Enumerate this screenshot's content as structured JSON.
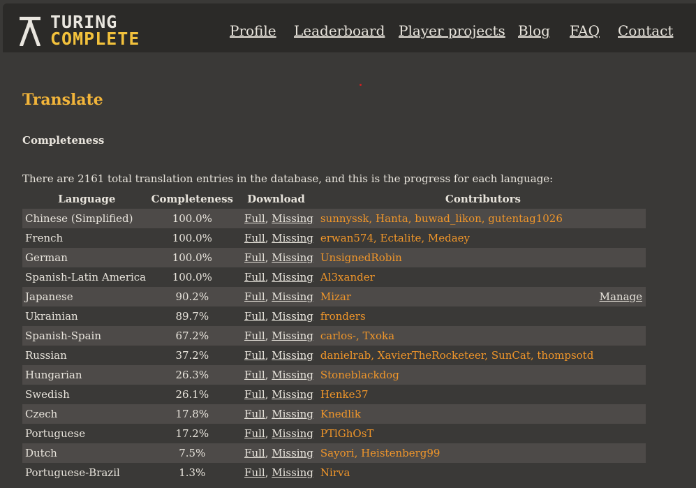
{
  "header": {
    "logo_line1": "TURING",
    "logo_line2": "COMPLETE",
    "nav": [
      "Profile",
      "Leaderboard",
      "Player projects",
      "Blog",
      "FAQ",
      "Contact"
    ]
  },
  "page": {
    "title": "Translate",
    "section": "Completeness",
    "intro": "There are 2161 total translation entries in the database, and this is the progress for each language:"
  },
  "table": {
    "headers": [
      "Language",
      "Completeness",
      "Download",
      "Contributors"
    ],
    "full_label": "Full",
    "missing_label": "Missing",
    "separator": ", ",
    "manage_label": "Manage",
    "rows": [
      {
        "language": "Chinese (Simplified)",
        "completeness": "100.0%",
        "contributors": "sunnyssk, Hanta, buwad_likon, gutentag1026"
      },
      {
        "language": "French",
        "completeness": "100.0%",
        "contributors": "erwan574, Ectalite, Medaey"
      },
      {
        "language": "German",
        "completeness": "100.0%",
        "contributors": "UnsignedRobin"
      },
      {
        "language": "Spanish-Latin America",
        "completeness": "100.0%",
        "contributors": "Al3xander"
      },
      {
        "language": "Japanese",
        "completeness": "90.2%",
        "contributors": "Mizar",
        "manage": true
      },
      {
        "language": "Ukrainian",
        "completeness": "89.7%",
        "contributors": "fronders"
      },
      {
        "language": "Spanish-Spain",
        "completeness": "67.2%",
        "contributors": "carlos-, Txoka"
      },
      {
        "language": "Russian",
        "completeness": "37.2%",
        "contributors": "danielrab, XavierTheRocketeer, SunCat, thompsotd"
      },
      {
        "language": "Hungarian",
        "completeness": "26.3%",
        "contributors": "Stoneblackdog"
      },
      {
        "language": "Swedish",
        "completeness": "26.1%",
        "contributors": "Henke37"
      },
      {
        "language": "Czech",
        "completeness": "17.8%",
        "contributors": "Knedlik"
      },
      {
        "language": "Portuguese",
        "completeness": "17.2%",
        "contributors": "PTlGhOsT"
      },
      {
        "language": "Dutch",
        "completeness": "7.5%",
        "contributors": "Sayori, Heistenberg99"
      },
      {
        "language": "Portuguese-Brazil",
        "completeness": "1.3%",
        "contributors": "Nirva"
      }
    ]
  },
  "colors": {
    "background": "#3a3937",
    "header_bg": "#2b2a28",
    "accent_title": "#f2b53a",
    "contributor": "#f0962a",
    "logo_yellow": "#f2c13c",
    "row_stripe": "#4d4a48"
  }
}
